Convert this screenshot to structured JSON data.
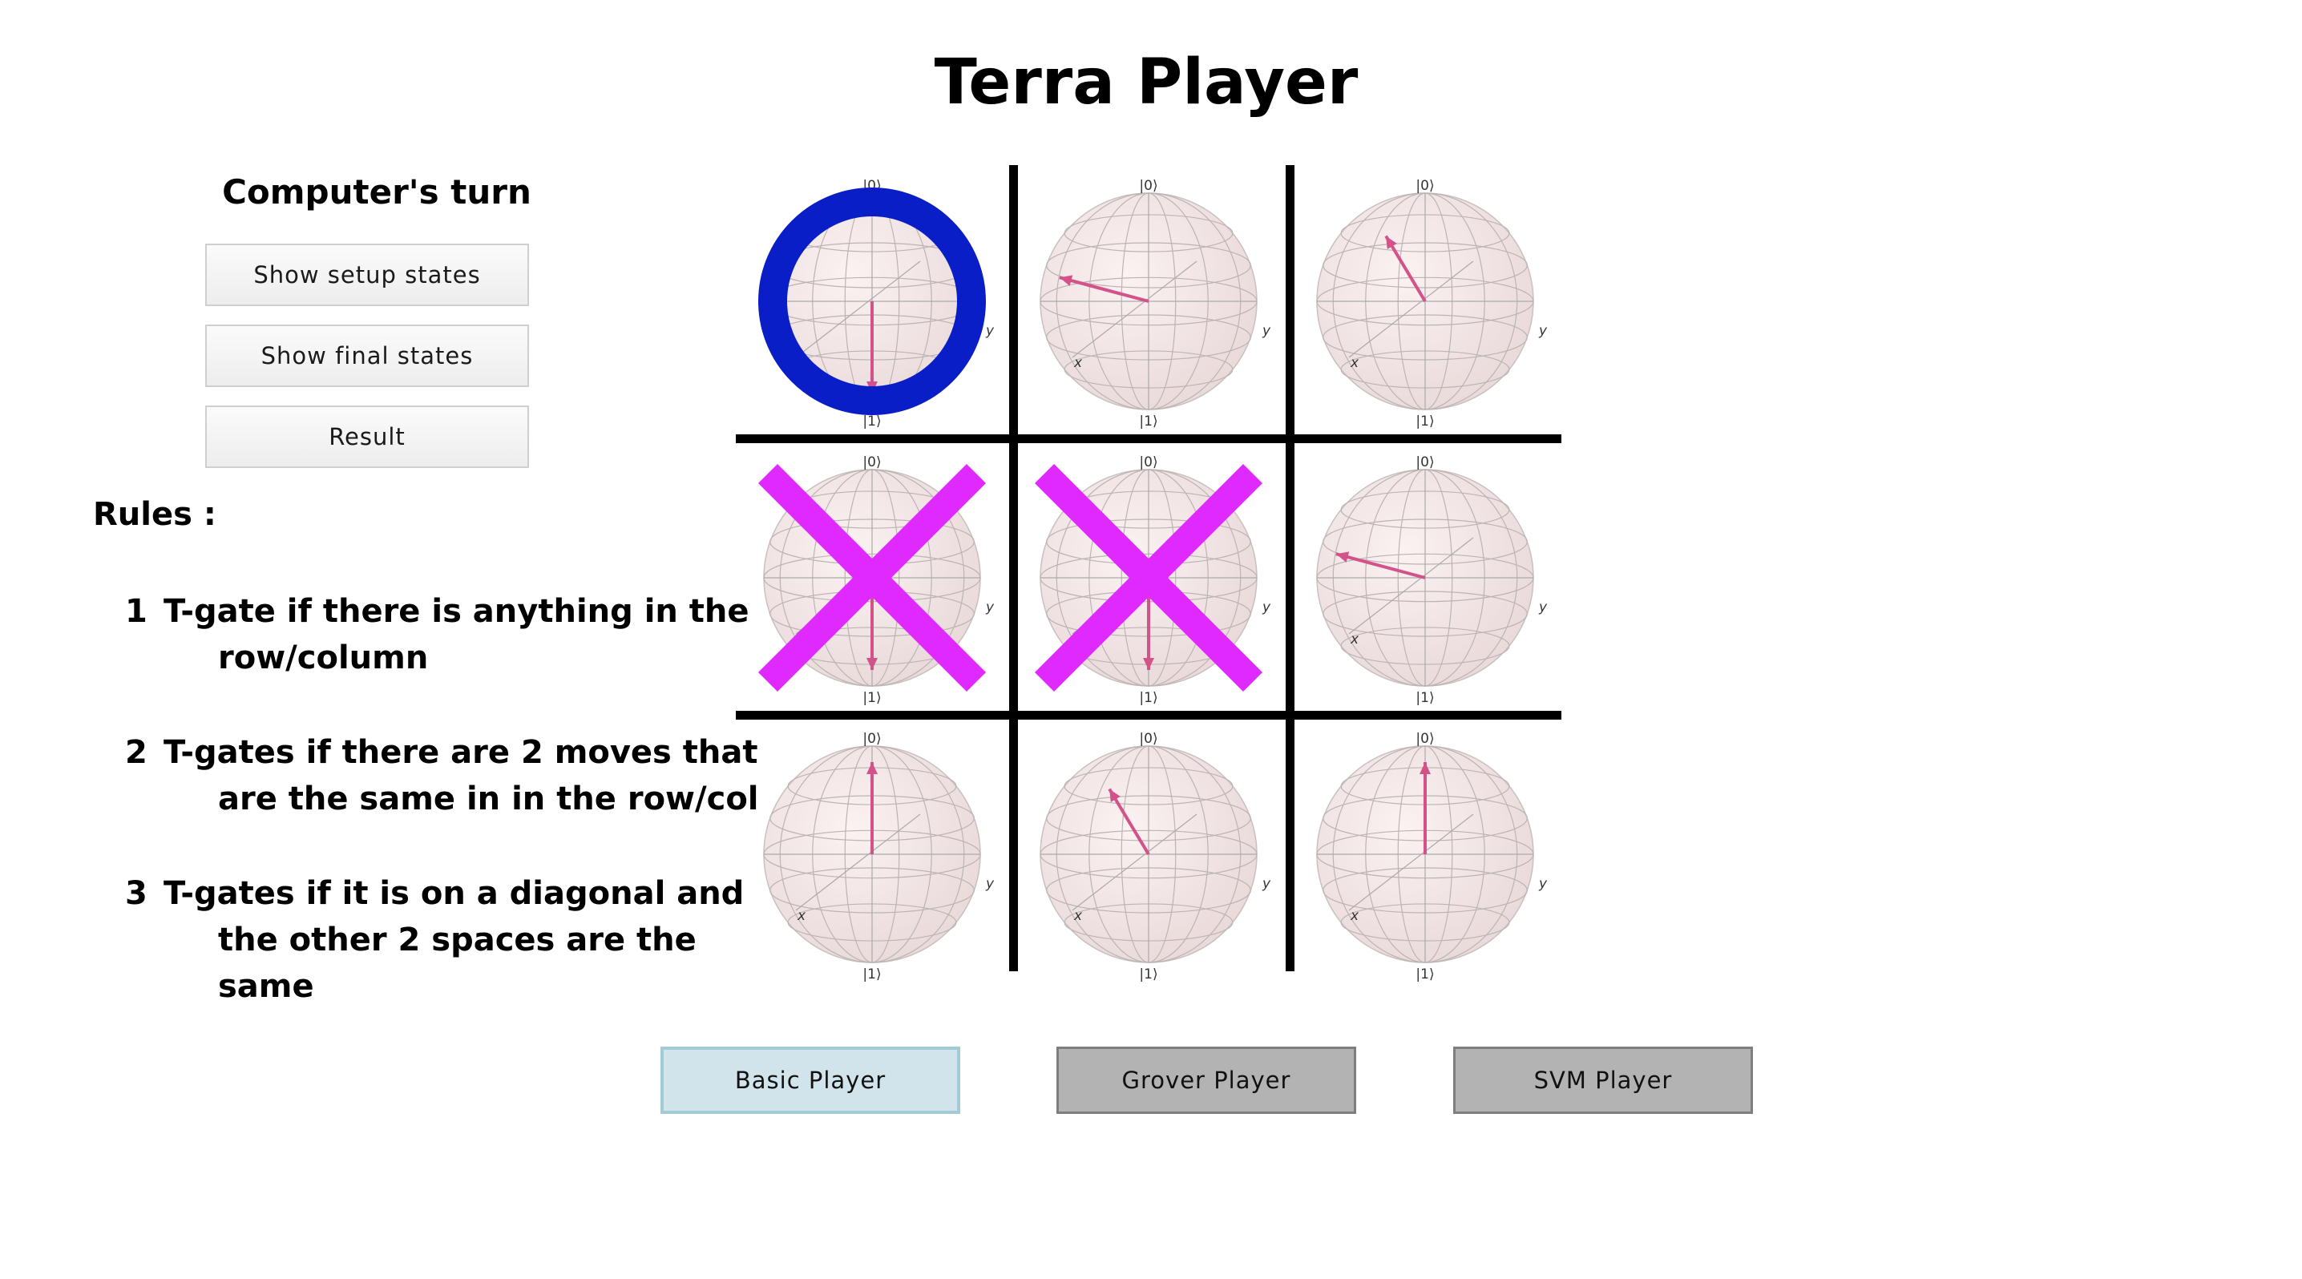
{
  "title": "Terra Player",
  "status": "Computer's turn",
  "side_buttons": [
    {
      "label": "Show setup states"
    },
    {
      "label": "Show final states"
    },
    {
      "label": "Result"
    }
  ],
  "rules": {
    "heading": "Rules :",
    "items": [
      {
        "num": "1",
        "line1": "T-gate if there is anything in the",
        "line2": "row/column"
      },
      {
        "num": "2",
        "line1": "T-gates if there are 2 moves that",
        "line2": "are the same in in the row/col"
      },
      {
        "num": "3",
        "line1": "T-gates if it is on a diagonal and",
        "line2": "the other 2 spaces are the same"
      }
    ]
  },
  "bloch": {
    "ket0": "|0⟩",
    "ket1": "|1⟩",
    "x": "x",
    "y": "y"
  },
  "board": [
    {
      "vector": "down",
      "mark": "O",
      "x_axis_label": false
    },
    {
      "vector": "left-slight-up",
      "mark": "",
      "x_axis_label": true
    },
    {
      "vector": "up-left",
      "mark": "",
      "x_axis_label": true
    },
    {
      "vector": "down",
      "mark": "X",
      "x_axis_label": false
    },
    {
      "vector": "down",
      "mark": "X",
      "x_axis_label": false
    },
    {
      "vector": "left-slight-up",
      "mark": "",
      "x_axis_label": true
    },
    {
      "vector": "up",
      "mark": "",
      "x_axis_label": true
    },
    {
      "vector": "up-left",
      "mark": "",
      "x_axis_label": true
    },
    {
      "vector": "up",
      "mark": "",
      "x_axis_label": true
    }
  ],
  "colors": {
    "o_mark": "#0a1ec8",
    "x_mark": "#e029ff",
    "vector": "#d4528a",
    "active_player": "#d1e4ec",
    "idle_player": "#b3b3b3"
  },
  "player_buttons": [
    {
      "label": "Basic Player",
      "active": true
    },
    {
      "label": "Grover Player",
      "active": false
    },
    {
      "label": "SVM Player",
      "active": false
    }
  ]
}
